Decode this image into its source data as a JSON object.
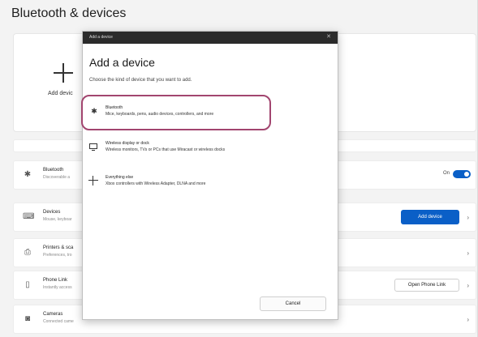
{
  "page": {
    "title": "Bluetooth & devices"
  },
  "add_device_tile": {
    "label": "Add devic"
  },
  "rows": [
    {
      "id": "bluetooth",
      "title": "Bluetooth",
      "subtitle": "Discoverable a",
      "toggle_label": "On",
      "toggle_state": "on"
    },
    {
      "id": "devices",
      "title": "Devices",
      "subtitle": "Mouse, keyboar",
      "button": "Add device"
    },
    {
      "id": "printers",
      "title": "Printers & sca",
      "subtitle": "Preferences, tro"
    },
    {
      "id": "phone-link",
      "title": "Phone Link",
      "subtitle": "Instantly access",
      "button": "Open Phone Link"
    },
    {
      "id": "cameras",
      "title": "Cameras",
      "subtitle": "Connected came"
    }
  ],
  "dialog": {
    "titlebar": "Add a device",
    "heading": "Add a device",
    "subtitle": "Choose the kind of device that you want to add.",
    "options": [
      {
        "title": "Bluetooth",
        "desc": "Mice, keyboards, pens, audio devices, controllers, and more",
        "highlighted": true
      },
      {
        "title": "Wireless display or dock",
        "desc": "Wireless monitors, TVs or PCs that use Miracast or wireless docks"
      },
      {
        "title": "Everything else",
        "desc": "Xbox controllers with Wireless Adapter, DLNA and more"
      }
    ],
    "cancel": "Cancel"
  },
  "colors": {
    "accent": "#0a5fc7",
    "highlight": "#a2456f",
    "titlebar": "#2b2b2b"
  }
}
